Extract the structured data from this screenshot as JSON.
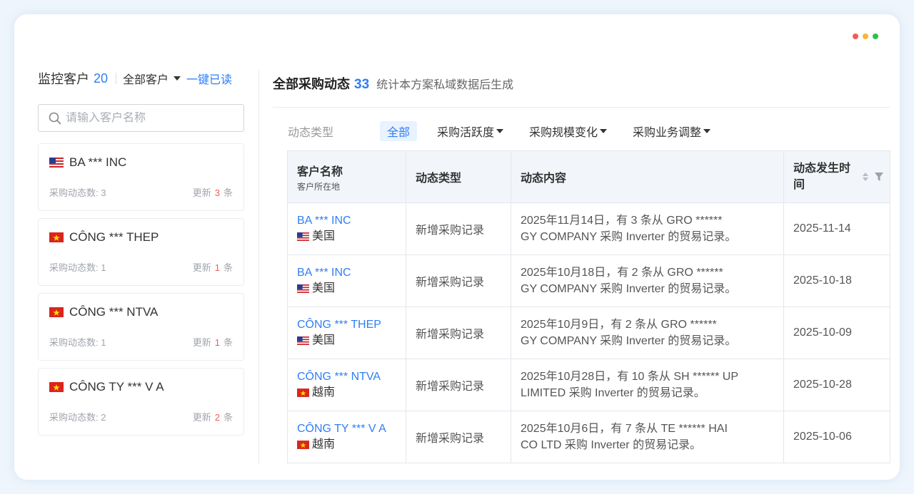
{
  "window_dots": {
    "colors": [
      "#f25c54",
      "#f5b63b",
      "#2bc24a"
    ]
  },
  "left": {
    "title": "监控客户",
    "count": "20",
    "filter_label": "全部客户",
    "mark_read": "一键已读",
    "search_placeholder": "请输入客户名称",
    "customers": [
      {
        "flag": "us",
        "name": "BA *** INC",
        "count_label": "采购动态数: 3",
        "update_prefix": "更新",
        "update_num": "3",
        "update_suffix": "条"
      },
      {
        "flag": "vn",
        "name": "CÔNG *** THEP",
        "count_label": "采购动态数: 1",
        "update_prefix": "更新",
        "update_num": "1",
        "update_suffix": "条"
      },
      {
        "flag": "vn",
        "name": "CÔNG *** NTVA",
        "count_label": "采购动态数: 1",
        "update_prefix": "更新",
        "update_num": "1",
        "update_suffix": "条"
      },
      {
        "flag": "vn",
        "name": "CÔNG TY *** V A",
        "count_label": "采购动态数: 2",
        "update_prefix": "更新",
        "update_num": "2",
        "update_suffix": "条"
      }
    ]
  },
  "right": {
    "title": "全部采购动态",
    "count": "33",
    "description": "统计本方案私域数据后生成",
    "types_label": "动态类型",
    "type_tabs": [
      {
        "label": "全部",
        "active": true
      },
      {
        "label": "采购活跃度",
        "active": false
      },
      {
        "label": "采购规模变化",
        "active": false
      },
      {
        "label": "采购业务调整",
        "active": false
      }
    ],
    "table": {
      "headers": {
        "customer": "客户名称",
        "customer_sub": "客户所在地",
        "type": "动态类型",
        "content": "动态内容",
        "time": "动态发生时间"
      },
      "rows": [
        {
          "name": "BA *** INC",
          "flag": "us",
          "country": "美国",
          "type": "新增采购记录",
          "content_line1": "2025年11月14日，有 3 条从 GRO ******",
          "content_line2": "GY COMPANY 采购 Inverter 的贸易记录。",
          "date": "2025-11-14"
        },
        {
          "name": "BA *** INC",
          "flag": "us",
          "country": "美国",
          "type": "新增采购记录",
          "content_line1": "2025年10月18日，有 2 条从 GRO ******",
          "content_line2": "GY COMPANY 采购 Inverter 的贸易记录。",
          "date": "2025-10-18"
        },
        {
          "name": "CÔNG *** THEP",
          "flag": "us",
          "country": "美国",
          "type": "新增采购记录",
          "content_line1": "2025年10月9日，有 2 条从 GRO   ******",
          "content_line2": "GY COMPANY 采购 Inverter 的贸易记录。",
          "date": "2025-10-09"
        },
        {
          "name": "CÔNG *** NTVA",
          "flag": "vn",
          "country": "越南",
          "type": "新增采购记录",
          "content_line1": "2025年10月28日，有 10 条从 SH  ****** UP",
          "content_line2": "LIMITED 采购 Inverter 的贸易记录。",
          "date": "2025-10-28"
        },
        {
          "name": "CÔNG TY *** V A",
          "flag": "vn",
          "country": "越南",
          "type": "新增采购记录",
          "content_line1": "2025年10月6日，有 7 条从 TE      ****** HAI",
          "content_line2": "CO LTD 采购 Inverter 的贸易记录。",
          "date": "2025-10-06"
        }
      ]
    }
  },
  "colors": {
    "accent": "#2f7ef5",
    "update_num": "#f25c54"
  }
}
